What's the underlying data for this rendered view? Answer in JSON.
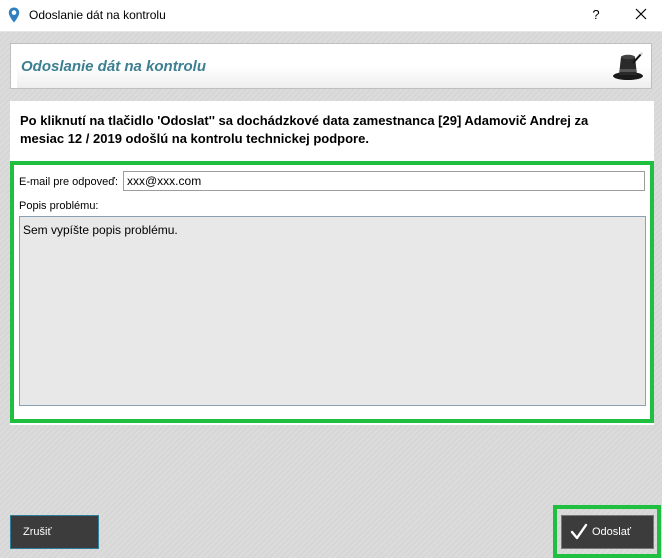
{
  "window": {
    "title": "Odoslanie dát na kontrolu",
    "help_label": "?",
    "icons": {
      "app": "location-pin-icon",
      "close": "close-icon"
    }
  },
  "header": {
    "title": "Odoslanie dát na kontrolu",
    "icon": "magic-hat-icon"
  },
  "info": {
    "line1": "Po kliknutí na tlačidlo 'Odoslat'' sa dochádzkové data zamestnanca [29] Adamovič Andrej  za",
    "line2": "mesiac 12 / 2019 odošlú na kontrolu technickej podpore."
  },
  "form": {
    "email_label": "E-mail pre odpoveď:",
    "email_value": "xxx@xxx.com",
    "description_label": "Popis problému:",
    "description_value": "Sem vypíšte popis problému."
  },
  "buttons": {
    "cancel_label": "Zrušiť",
    "send_label": "Odoslať",
    "send_icon": "checkmark-icon"
  },
  "colors": {
    "accent_title": "#3b7f90",
    "highlight": "#1fbf3f",
    "button_bg": "#3c3c3c"
  }
}
